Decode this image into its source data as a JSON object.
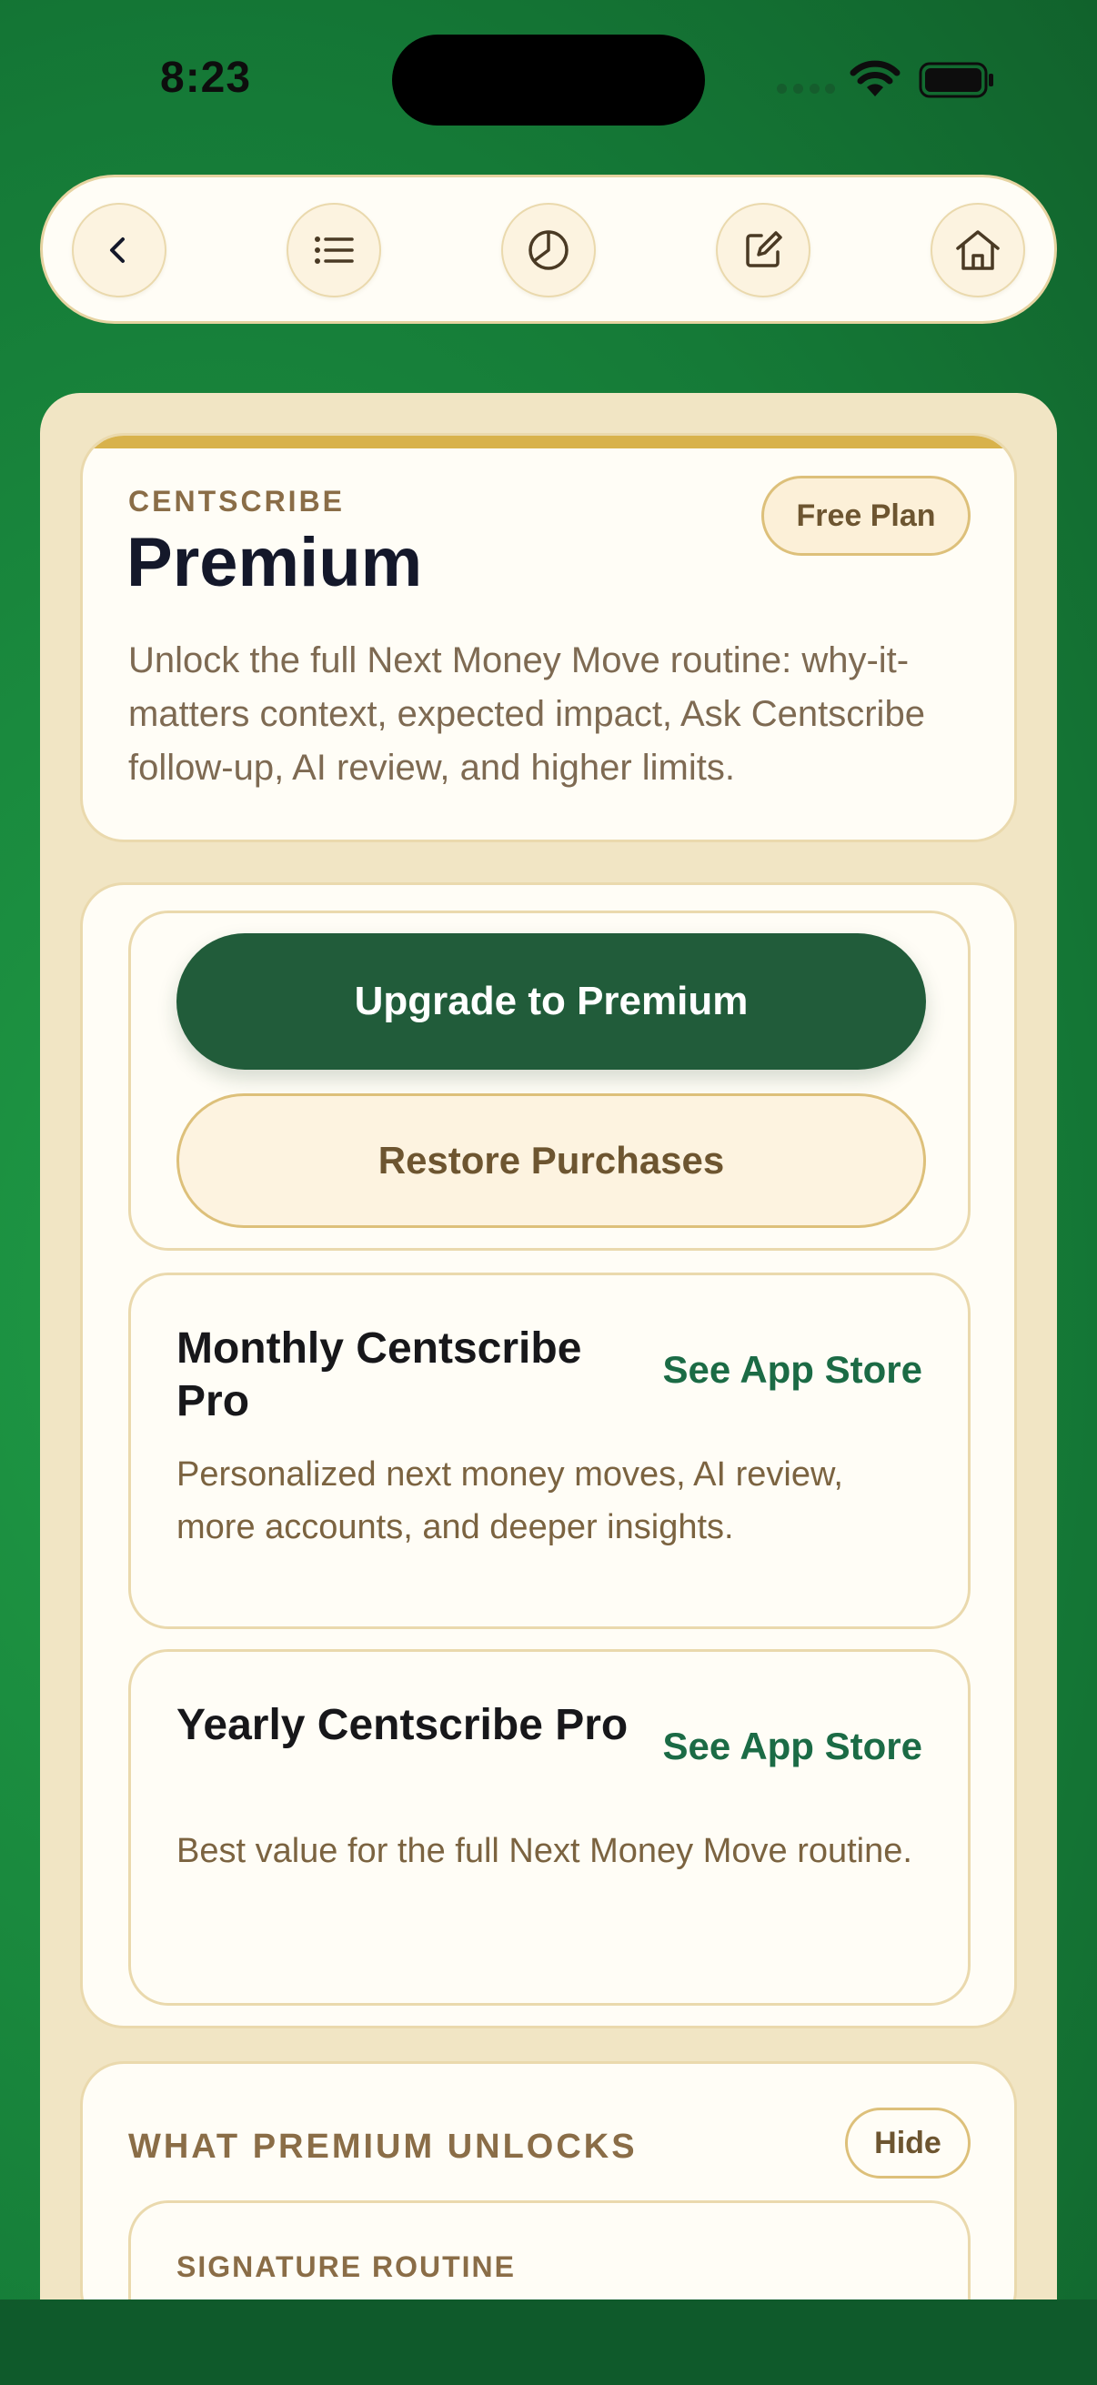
{
  "status_bar": {
    "time": "8:23",
    "icons": [
      "signal-icon",
      "wifi-icon",
      "battery-icon"
    ]
  },
  "nav": {
    "buttons": [
      {
        "icon": "back-chevron-icon"
      },
      {
        "icon": "list-icon"
      },
      {
        "icon": "pie-chart-icon"
      },
      {
        "icon": "edit-icon"
      },
      {
        "icon": "home-icon"
      }
    ]
  },
  "hero": {
    "eyebrow": "CENTSCRIBE",
    "title": "Premium",
    "badge": "Free Plan",
    "description": "Unlock the full Next Money Move routine: why-it-matters context, expected impact, Ask Centscribe follow-up, AI review, and higher limits."
  },
  "actions": {
    "upgrade_label": "Upgrade to Premium",
    "restore_label": "Restore Purchases"
  },
  "plans": [
    {
      "title": "Monthly Centscribe Pro",
      "link": "See App Store",
      "description": "Personalized next money moves, AI review, more accounts, and deeper insights."
    },
    {
      "title": "Yearly Centscribe Pro",
      "link": "See App Store",
      "description": "Best value for the full Next Money Move routine."
    }
  ],
  "unlocks": {
    "title": "WHAT PREMIUM UNLOCKS",
    "hide_label": "Hide",
    "first_item_label": "SIGNATURE ROUTINE"
  },
  "colors": {
    "background": "#1a8a3e",
    "primary_button": "#215c3a",
    "accent_link": "#1b6b45",
    "panel": "#f1e5c4",
    "card": "#fffdf6",
    "gold_bar": "#d8b24c"
  }
}
